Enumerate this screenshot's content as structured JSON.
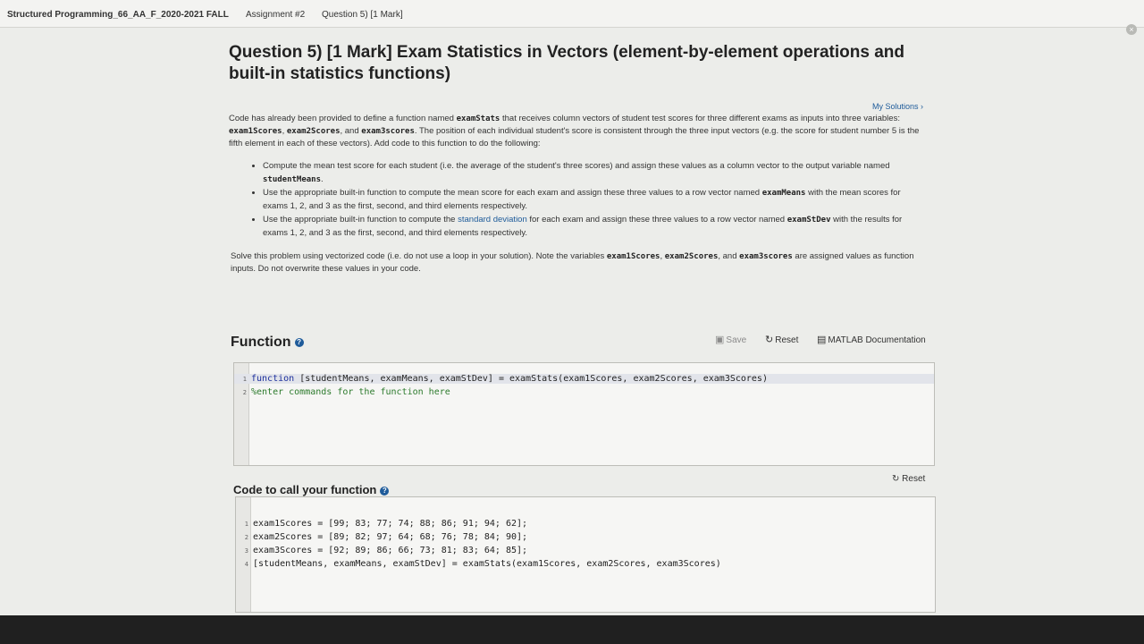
{
  "breadcrumbs": {
    "course": "Structured Programming_66_AA_F_2020-2021 FALL",
    "assignment": "Assignment #2",
    "question": "Question 5) [1 Mark]"
  },
  "title": {
    "line1": "Question 5) [1 Mark] Exam Statistics in Vectors (element-by-element operations and",
    "line2": "built-in statistics functions)"
  },
  "my_solutions": "My Solutions ›",
  "intro": {
    "t1": "Code has already been provided to define a function named ",
    "c1": "examStats",
    "t2": " that receives column vectors of student test scores for three different exams as inputs into three variables: ",
    "c2": "exam1Scores",
    "t3": ", ",
    "c3": "exam2Scores",
    "t4": ", and ",
    "c4": "exam3scores",
    "t5": ". The position of each individual student's score is consistent through the three input vectors (e.g. the score for student number 5 is the fifth element in each of these vectors). Add code to this function to do the following:"
  },
  "bullets": {
    "b1_t1": "Compute the mean test score for each student (i.e. the average of the student's three scores) and assign these values as a column vector to the output variable named ",
    "b1_c1": "studentMeans",
    "b1_t2": ".",
    "b2_t1": "Use the appropriate built-in function to compute the mean score for each exam and assign these three values to a row vector named ",
    "b2_c1": "examMeans",
    "b2_t2": " with the mean scores for exams 1, 2, and 3 as the first, second, and third elements respectively.",
    "b3_t1": "Use the appropriate built-in function to compute the ",
    "b3_link": "standard deviation",
    "b3_t2": " for each exam and assign these three values to a row vector named ",
    "b3_c1": "examStDev",
    "b3_t3": " with the results for exams 1, 2, and 3 as the first, second, and third elements respectively."
  },
  "solve": {
    "t1": "Solve this problem using vectorized code (i.e. do not use a loop in your solution). Note the variables ",
    "c1": "exam1Scores",
    "t2": ", ",
    "c2": "exam2Scores",
    "t3": ", and ",
    "c3": "exam3scores",
    "t4": " are assigned values as function inputs. Do not overwrite these values in your code."
  },
  "function_section": {
    "title": "Function",
    "save": "Save",
    "reset": "Reset",
    "matlab_doc": "MATLAB Documentation",
    "lines": [
      {
        "num": "1",
        "kw": "function",
        "rest": " [studentMeans, examMeans, examStDev] = examStats(exam1Scores, exam2Scores, exam3Scores)"
      },
      {
        "num": "2",
        "comment": "%enter commands for the function here"
      }
    ]
  },
  "call_section": {
    "title": "Code to call your function",
    "reset": "Reset",
    "lines": [
      {
        "num": "1",
        "text": "exam1Scores = [99; 83; 77; 74; 88; 86; 91; 94; 62];"
      },
      {
        "num": "2",
        "text": "exam2Scores = [89; 82; 97; 64; 68; 76; 78; 84; 90];"
      },
      {
        "num": "3",
        "text": "exam3Scores = [92; 89; 86; 66; 73; 81; 83; 64; 85];"
      },
      {
        "num": "4",
        "text": "[studentMeans, examMeans, examStDev] = examStats(exam1Scores, exam2Scores, exam3Scores)"
      }
    ]
  },
  "icons": {
    "help": "question-circle-icon",
    "save": "floppy-disk-icon",
    "reset": "refresh-icon",
    "matlab": "book-icon",
    "close": "close-circle-icon"
  },
  "colors": {
    "link": "#1e5b9a",
    "keyword": "#1d2f9c",
    "comment": "#2c7a2c"
  }
}
